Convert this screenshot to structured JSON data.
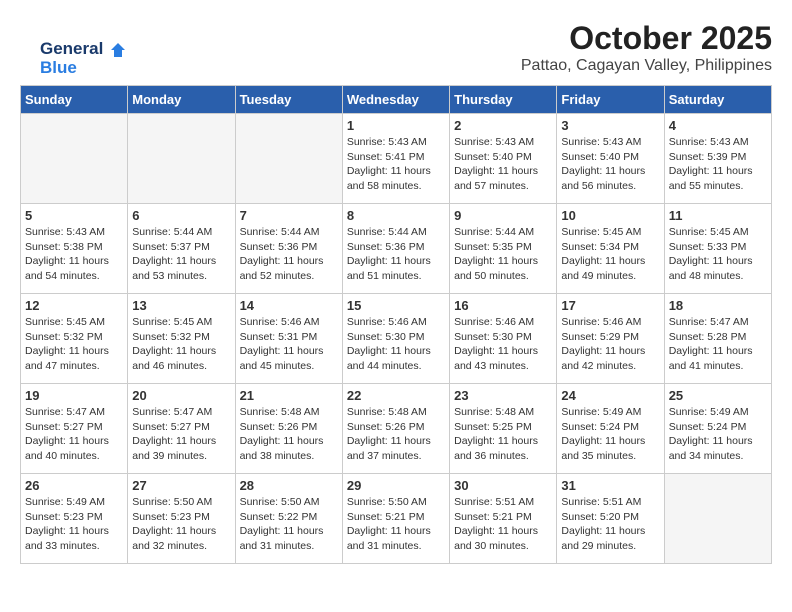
{
  "logo": {
    "line1": "General",
    "line2": "Blue"
  },
  "header": {
    "title": "October 2025",
    "subtitle": "Pattao, Cagayan Valley, Philippines"
  },
  "weekdays": [
    "Sunday",
    "Monday",
    "Tuesday",
    "Wednesday",
    "Thursday",
    "Friday",
    "Saturday"
  ],
  "weeks": [
    [
      {
        "day": "",
        "text": ""
      },
      {
        "day": "",
        "text": ""
      },
      {
        "day": "",
        "text": ""
      },
      {
        "day": "1",
        "text": "Sunrise: 5:43 AM\nSunset: 5:41 PM\nDaylight: 11 hours\nand 58 minutes."
      },
      {
        "day": "2",
        "text": "Sunrise: 5:43 AM\nSunset: 5:40 PM\nDaylight: 11 hours\nand 57 minutes."
      },
      {
        "day": "3",
        "text": "Sunrise: 5:43 AM\nSunset: 5:40 PM\nDaylight: 11 hours\nand 56 minutes."
      },
      {
        "day": "4",
        "text": "Sunrise: 5:43 AM\nSunset: 5:39 PM\nDaylight: 11 hours\nand 55 minutes."
      }
    ],
    [
      {
        "day": "5",
        "text": "Sunrise: 5:43 AM\nSunset: 5:38 PM\nDaylight: 11 hours\nand 54 minutes."
      },
      {
        "day": "6",
        "text": "Sunrise: 5:44 AM\nSunset: 5:37 PM\nDaylight: 11 hours\nand 53 minutes."
      },
      {
        "day": "7",
        "text": "Sunrise: 5:44 AM\nSunset: 5:36 PM\nDaylight: 11 hours\nand 52 minutes."
      },
      {
        "day": "8",
        "text": "Sunrise: 5:44 AM\nSunset: 5:36 PM\nDaylight: 11 hours\nand 51 minutes."
      },
      {
        "day": "9",
        "text": "Sunrise: 5:44 AM\nSunset: 5:35 PM\nDaylight: 11 hours\nand 50 minutes."
      },
      {
        "day": "10",
        "text": "Sunrise: 5:45 AM\nSunset: 5:34 PM\nDaylight: 11 hours\nand 49 minutes."
      },
      {
        "day": "11",
        "text": "Sunrise: 5:45 AM\nSunset: 5:33 PM\nDaylight: 11 hours\nand 48 minutes."
      }
    ],
    [
      {
        "day": "12",
        "text": "Sunrise: 5:45 AM\nSunset: 5:32 PM\nDaylight: 11 hours\nand 47 minutes."
      },
      {
        "day": "13",
        "text": "Sunrise: 5:45 AM\nSunset: 5:32 PM\nDaylight: 11 hours\nand 46 minutes."
      },
      {
        "day": "14",
        "text": "Sunrise: 5:46 AM\nSunset: 5:31 PM\nDaylight: 11 hours\nand 45 minutes."
      },
      {
        "day": "15",
        "text": "Sunrise: 5:46 AM\nSunset: 5:30 PM\nDaylight: 11 hours\nand 44 minutes."
      },
      {
        "day": "16",
        "text": "Sunrise: 5:46 AM\nSunset: 5:30 PM\nDaylight: 11 hours\nand 43 minutes."
      },
      {
        "day": "17",
        "text": "Sunrise: 5:46 AM\nSunset: 5:29 PM\nDaylight: 11 hours\nand 42 minutes."
      },
      {
        "day": "18",
        "text": "Sunrise: 5:47 AM\nSunset: 5:28 PM\nDaylight: 11 hours\nand 41 minutes."
      }
    ],
    [
      {
        "day": "19",
        "text": "Sunrise: 5:47 AM\nSunset: 5:27 PM\nDaylight: 11 hours\nand 40 minutes."
      },
      {
        "day": "20",
        "text": "Sunrise: 5:47 AM\nSunset: 5:27 PM\nDaylight: 11 hours\nand 39 minutes."
      },
      {
        "day": "21",
        "text": "Sunrise: 5:48 AM\nSunset: 5:26 PM\nDaylight: 11 hours\nand 38 minutes."
      },
      {
        "day": "22",
        "text": "Sunrise: 5:48 AM\nSunset: 5:26 PM\nDaylight: 11 hours\nand 37 minutes."
      },
      {
        "day": "23",
        "text": "Sunrise: 5:48 AM\nSunset: 5:25 PM\nDaylight: 11 hours\nand 36 minutes."
      },
      {
        "day": "24",
        "text": "Sunrise: 5:49 AM\nSunset: 5:24 PM\nDaylight: 11 hours\nand 35 minutes."
      },
      {
        "day": "25",
        "text": "Sunrise: 5:49 AM\nSunset: 5:24 PM\nDaylight: 11 hours\nand 34 minutes."
      }
    ],
    [
      {
        "day": "26",
        "text": "Sunrise: 5:49 AM\nSunset: 5:23 PM\nDaylight: 11 hours\nand 33 minutes."
      },
      {
        "day": "27",
        "text": "Sunrise: 5:50 AM\nSunset: 5:23 PM\nDaylight: 11 hours\nand 32 minutes."
      },
      {
        "day": "28",
        "text": "Sunrise: 5:50 AM\nSunset: 5:22 PM\nDaylight: 11 hours\nand 31 minutes."
      },
      {
        "day": "29",
        "text": "Sunrise: 5:50 AM\nSunset: 5:21 PM\nDaylight: 11 hours\nand 31 minutes."
      },
      {
        "day": "30",
        "text": "Sunrise: 5:51 AM\nSunset: 5:21 PM\nDaylight: 11 hours\nand 30 minutes."
      },
      {
        "day": "31",
        "text": "Sunrise: 5:51 AM\nSunset: 5:20 PM\nDaylight: 11 hours\nand 29 minutes."
      },
      {
        "day": "",
        "text": ""
      }
    ]
  ]
}
